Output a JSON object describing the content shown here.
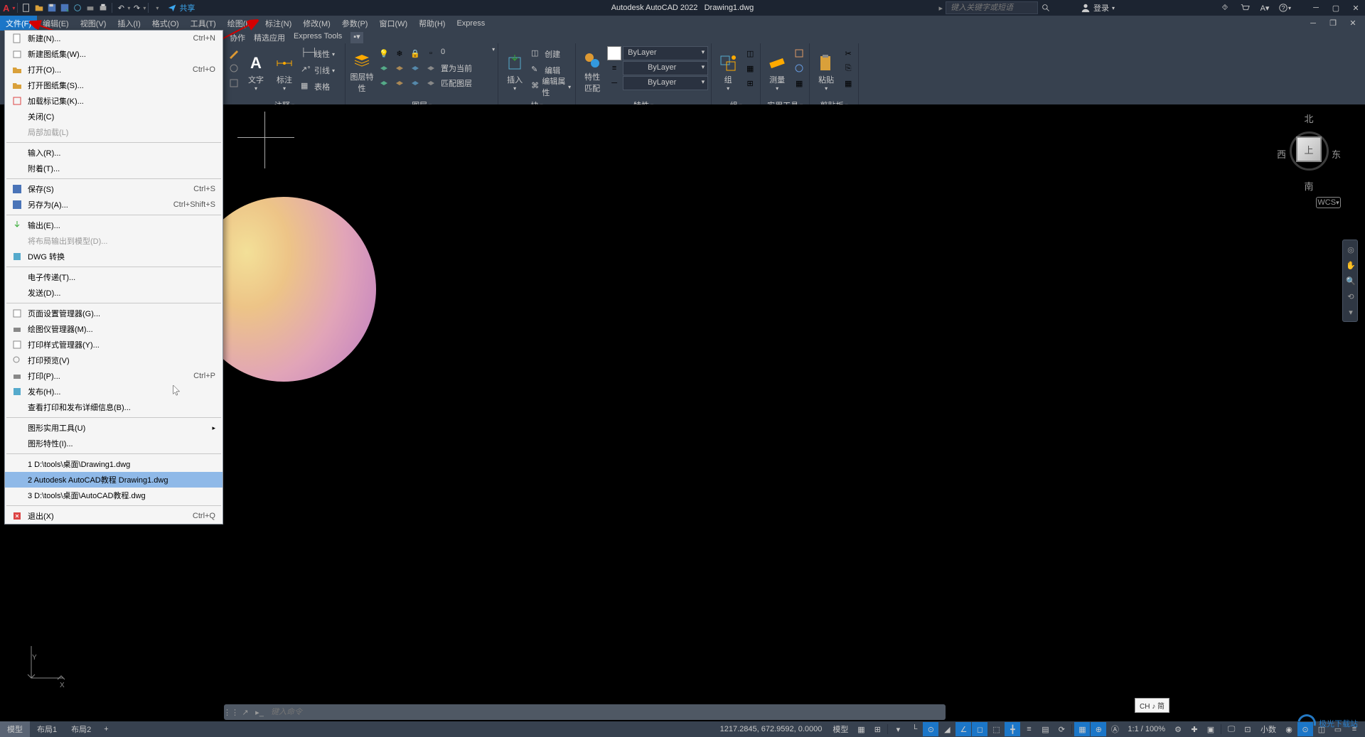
{
  "app": {
    "name": "Autodesk AutoCAD 2022",
    "doc": "Drawing1.dwg",
    "share": "共享",
    "login": "登录",
    "search_placeholder": "键入关键字或短语"
  },
  "menu": {
    "file": "文件(F)",
    "edit": "编辑(E)",
    "view": "视图(V)",
    "insert": "插入(I)",
    "format": "格式(O)",
    "tools": "工具(T)",
    "draw": "绘图(D)",
    "dimension": "标注(N)",
    "modify": "修改(M)",
    "params": "参数(P)",
    "window": "窗口(W)",
    "help": "帮助(H)",
    "express": "Express"
  },
  "tabs": {
    "collab": "协作",
    "featured": "精选应用",
    "expresstools": "Express Tools"
  },
  "panels": {
    "annotate": {
      "text": "文字",
      "dim": "标注",
      "linetype": "线性",
      "leader": "引线",
      "table": "表格",
      "title": "注释"
    },
    "layers": {
      "props": "图层特性",
      "current": "置为当前",
      "match": "匹配图层",
      "title": "图层"
    },
    "blocks": {
      "insert": "插入",
      "create": "创建",
      "edit": "编辑",
      "attr": "编辑属性",
      "title": "块"
    },
    "props": {
      "btn": "特性",
      "match": "匹配",
      "bylayer": "ByLayer",
      "title": "特性"
    },
    "groups": {
      "btn": "组",
      "title": "组"
    },
    "utils": {
      "measure": "测量",
      "title": "实用工具"
    },
    "clip": {
      "paste": "粘贴",
      "title": "剪贴板"
    }
  },
  "filemenu": {
    "new": {
      "t": "新建(N)...",
      "sc": "Ctrl+N"
    },
    "newsheet": {
      "t": "新建图纸集(W)..."
    },
    "open": {
      "t": "打开(O)...",
      "sc": "Ctrl+O"
    },
    "opensheet": {
      "t": "打开图纸集(S)..."
    },
    "loadmark": {
      "t": "加载标记集(K)..."
    },
    "close": {
      "t": "关闭(C)"
    },
    "partial": {
      "t": "局部加载(L)"
    },
    "import": {
      "t": "输入(R)..."
    },
    "attach": {
      "t": "附着(T)..."
    },
    "save": {
      "t": "保存(S)",
      "sc": "Ctrl+S"
    },
    "saveas": {
      "t": "另存为(A)...",
      "sc": "Ctrl+Shift+S"
    },
    "export": {
      "t": "输出(E)..."
    },
    "exportlayout": {
      "t": "将布局输出到模型(D)..."
    },
    "dwgconv": {
      "t": "DWG 转换"
    },
    "etransmit": {
      "t": "电子传递(T)..."
    },
    "send": {
      "t": "发送(D)..."
    },
    "pagesetup": {
      "t": "页面设置管理器(G)..."
    },
    "plotter": {
      "t": "绘图仪管理器(M)..."
    },
    "printstyle": {
      "t": "打印样式管理器(Y)..."
    },
    "preview": {
      "t": "打印预览(V)"
    },
    "print": {
      "t": "打印(P)...",
      "sc": "Ctrl+P"
    },
    "publish": {
      "t": "发布(H)..."
    },
    "details": {
      "t": "查看打印和发布详细信息(B)..."
    },
    "drawutil": {
      "t": "图形实用工具(U)"
    },
    "drawprops": {
      "t": "图形特性(I)..."
    },
    "recent1": {
      "t": "1 D:\\tools\\桌面\\Drawing1.dwg"
    },
    "recent2": {
      "t": "2 Autodesk AutoCAD教程 Drawing1.dwg"
    },
    "recent3": {
      "t": "3 D:\\tools\\桌面\\AutoCAD教程.dwg"
    },
    "exit": {
      "t": "退出(X)",
      "sc": "Ctrl+Q"
    }
  },
  "viewcube": {
    "n": "北",
    "s": "南",
    "e": "东",
    "w": "西",
    "top": "上",
    "wcs": "WCS"
  },
  "cmdline": {
    "placeholder": "键入命令"
  },
  "ime": {
    "label": "CH ♪ 简"
  },
  "status": {
    "model": "模型",
    "layout1": "布局1",
    "layout2": "布局2",
    "coords": "1217.2845, 672.9592, 0.0000",
    "modelbtn": "模型",
    "scale": "1:1 / 100%",
    "decimal": "小数"
  },
  "watermark": {
    "text": "极光下载站"
  }
}
